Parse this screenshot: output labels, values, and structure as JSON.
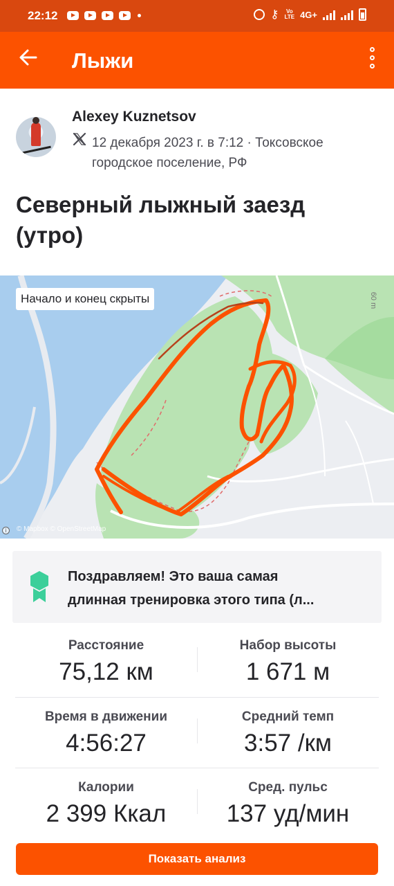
{
  "status_bar": {
    "time": "22:12",
    "network": "4G+",
    "icons": [
      "youtube-icon",
      "youtube-icon",
      "youtube-icon",
      "youtube-icon",
      "alarm-icon",
      "key-icon",
      "volte-icon",
      "signal-icon",
      "signal-icon",
      "battery-charging-icon"
    ]
  },
  "app_bar": {
    "title": "Лыжи",
    "back_icon": "arrow-left-icon",
    "menu_icon": "more-vertical-icon",
    "background": "#fc5200"
  },
  "author": {
    "name": "Alexey Kuznetsov",
    "meta": "12 декабря 2023 г. в 7:12 · Токсовское городское поселение, РФ",
    "platform_icon": "x-logo-icon"
  },
  "activity": {
    "title": "Северный лыжный заезд (утро)"
  },
  "map": {
    "privacy_badge": "Начало и конец скрыты",
    "attribution": "© Mapbox © OpenStreetMap",
    "scale_label": "60 m",
    "route_color": "#fc5200"
  },
  "achievement": {
    "icon": "achievement-badge-icon",
    "text_line1": "Поздравляем! Это ваша самая",
    "text_line2": "длинная тренировка этого типа (л...",
    "color": "#3ccf9a"
  },
  "stats": [
    {
      "label": "Расстояние",
      "value": "75,12 км"
    },
    {
      "label": "Набор высоты",
      "value": "1 671 м"
    },
    {
      "label": "Время в движении",
      "value": "4:56:27"
    },
    {
      "label": "Средний темп",
      "value": "3:57 /км"
    },
    {
      "label": "Калории",
      "value": "2 399 Ккал"
    },
    {
      "label": "Сред. пульс",
      "value": "137 уд/мин"
    }
  ],
  "analyze_button": {
    "label": "Показать анализ"
  }
}
